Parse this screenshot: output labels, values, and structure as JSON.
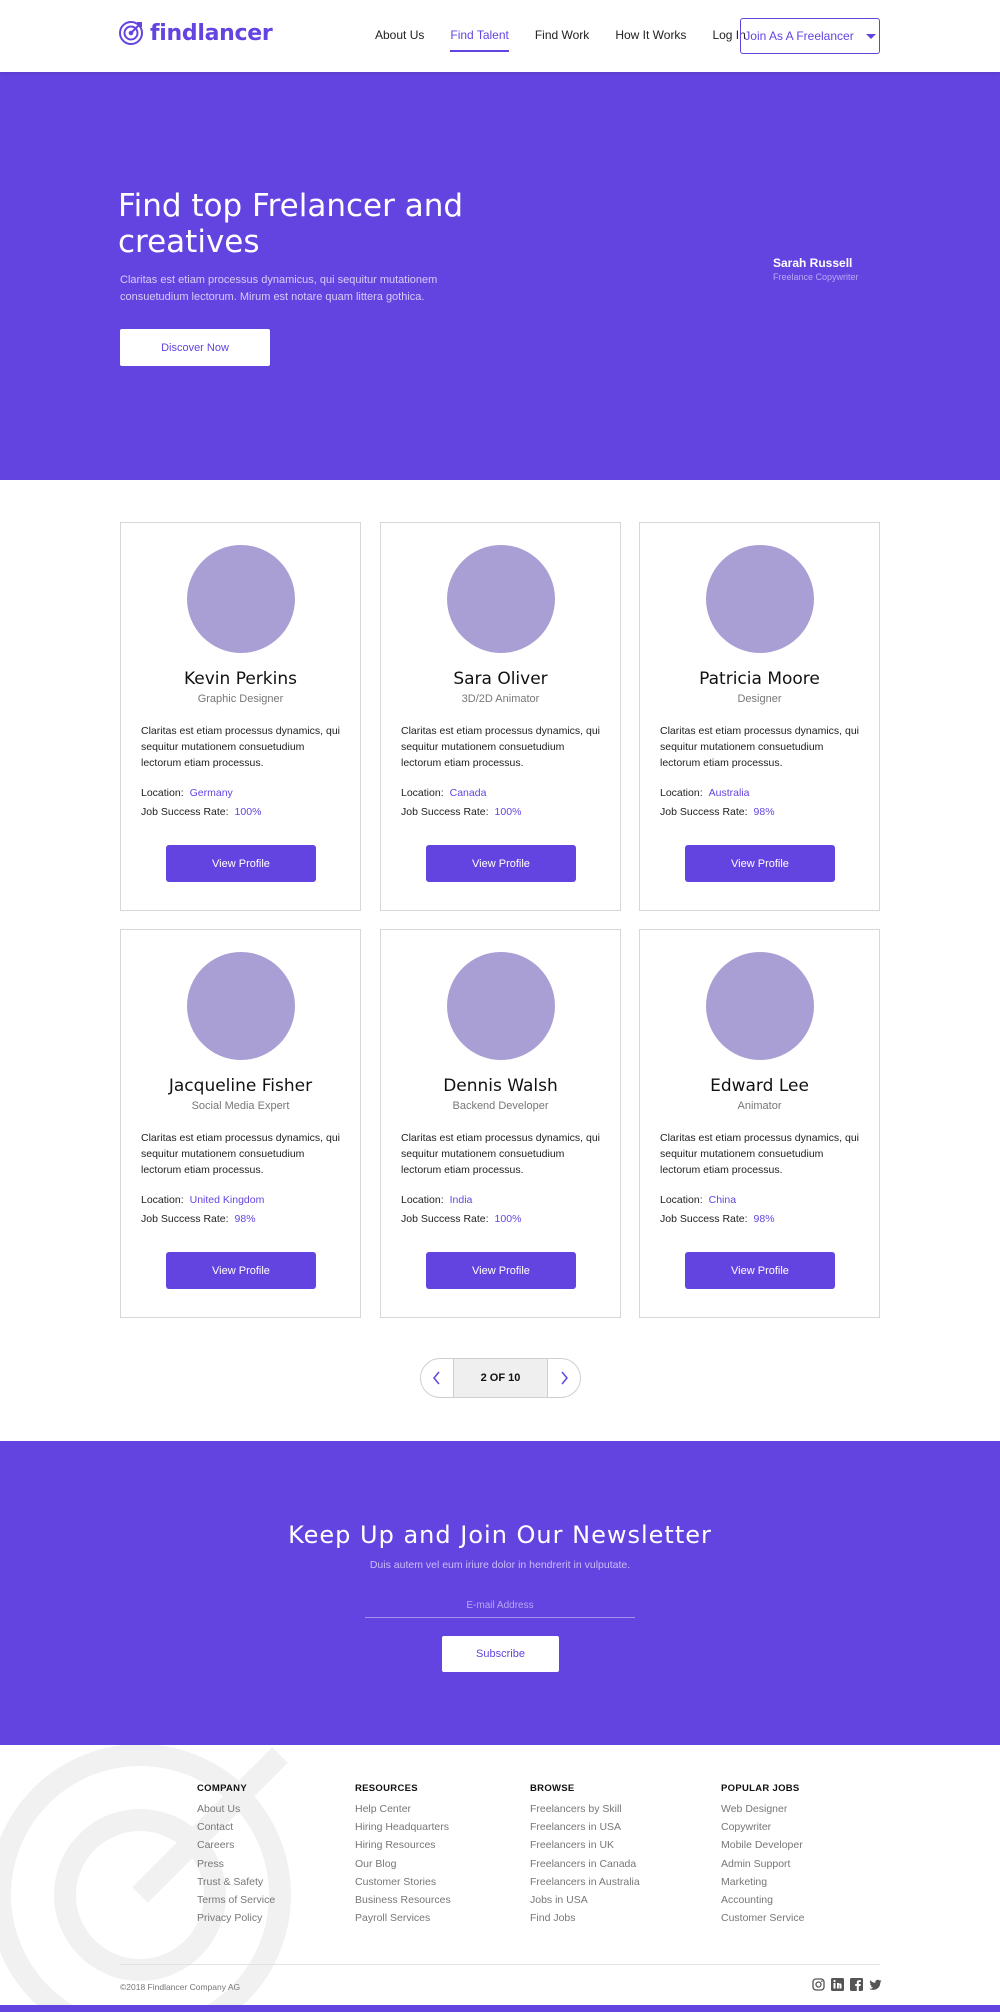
{
  "brand": {
    "name": "findlancer",
    "accent": "#6444e0",
    "logo_icon": "target-icon"
  },
  "nav": {
    "items": [
      {
        "label": "About Us",
        "active": false
      },
      {
        "label": "Find Talent",
        "active": true
      },
      {
        "label": "Find Work",
        "active": false
      },
      {
        "label": "How It Works",
        "active": false
      },
      {
        "label": "Log In",
        "active": false
      }
    ],
    "join_button": "Join As A Freelancer"
  },
  "hero": {
    "title": "Find top Frelancer and creatives",
    "description": "Claritas est etiam processus dynamicus, qui sequitur mutationem consuetudium lectorum. Mirum est notare quam littera gothica.",
    "cta": "Discover Now",
    "featured_name": "Sarah Russell",
    "featured_role": "Freelance Copywriter"
  },
  "freelancers": [
    {
      "name": "Kevin Perkins",
      "title": "Graphic Designer",
      "description": "Claritas est etiam processus dynamics, qui sequitur mutationem consuetudium lectorum etiam processus.",
      "location_label": "Location:",
      "location": "Germany",
      "rate_label": "Job Success Rate:",
      "rate": "100%",
      "button": "View Profile"
    },
    {
      "name": "Sara Oliver",
      "title": "3D/2D Animator",
      "description": "Claritas est etiam processus dynamics, qui sequitur mutationem consuetudium lectorum etiam processus.",
      "location_label": "Location:",
      "location": "Canada",
      "rate_label": "Job Success Rate:",
      "rate": "100%",
      "button": "View Profile"
    },
    {
      "name": "Patricia Moore",
      "title": "Designer",
      "description": "Claritas est etiam processus dynamics, qui sequitur mutationem consuetudium lectorum etiam processus.",
      "location_label": "Location:",
      "location": "Australia",
      "rate_label": "Job Success Rate:",
      "rate": "98%",
      "button": "View Profile"
    },
    {
      "name": "Jacqueline Fisher",
      "title": "Social Media Expert",
      "description": "Claritas est etiam processus dynamics, qui sequitur mutationem consuetudium lectorum etiam processus.",
      "location_label": "Location:",
      "location": "United Kingdom",
      "rate_label": "Job Success Rate:",
      "rate": "98%",
      "button": "View Profile"
    },
    {
      "name": "Dennis Walsh",
      "title": "Backend Developer",
      "description": "Claritas est etiam processus dynamics, qui sequitur mutationem consuetudium lectorum etiam processus.",
      "location_label": "Location:",
      "location": "India",
      "rate_label": "Job Success Rate:",
      "rate": "100%",
      "button": "View Profile"
    },
    {
      "name": "Edward Lee",
      "title": "Animator",
      "description": "Claritas est etiam processus dynamics, qui sequitur mutationem consuetudium lectorum etiam processus.",
      "location_label": "Location:",
      "location": "China",
      "rate_label": "Job Success Rate:",
      "rate": "98%",
      "button": "View Profile"
    }
  ],
  "pagination": {
    "label": "2 OF 10",
    "prev_icon": "chevron-left-icon",
    "next_icon": "chevron-right-icon"
  },
  "newsletter": {
    "title": "Keep Up and Join Our Newsletter",
    "subtitle": "Duis autem vel eum iriure dolor in hendrerit in vulputate.",
    "email_placeholder": "E-mail Address",
    "button": "Subscribe"
  },
  "footer": {
    "columns": [
      {
        "heading": "COMPANY",
        "links": [
          "About Us",
          "Contact",
          "Careers",
          "Press",
          "Trust & Safety",
          "Terms of Service",
          "Privacy Policy"
        ]
      },
      {
        "heading": "RESOURCES",
        "links": [
          "Help Center",
          "Hiring Headquarters",
          "Hiring Resources",
          "Our Blog",
          "Customer Stories",
          "Business Resources",
          "Payroll Services"
        ]
      },
      {
        "heading": "BROWSE",
        "links": [
          "Freelancers by Skill",
          "Freelancers in USA",
          "Freelancers in UK",
          "Freelancers in Canada",
          "Freelancers in Australia",
          "Jobs in USA",
          "Find Jobs"
        ]
      },
      {
        "heading": "POPULAR JOBS",
        "links": [
          "Web Designer",
          "Copywriter",
          "Mobile Developer",
          "Admin Support",
          "Marketing",
          "Accounting",
          "Customer Service"
        ]
      }
    ],
    "copyright": "©2018 Findlancer Company AG",
    "socials": [
      "instagram-icon",
      "linkedin-icon",
      "facebook-icon",
      "twitter-icon"
    ]
  }
}
